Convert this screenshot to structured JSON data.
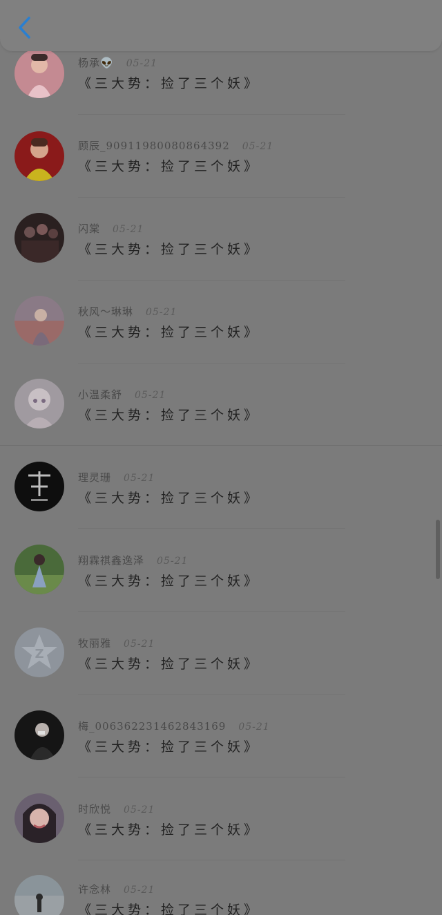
{
  "header": {
    "back_icon": "chevron-left-icon",
    "accent": "#2a7fd0"
  },
  "list": {
    "items": [
      {
        "name": "杨承👽",
        "time": "05-21",
        "title": "《三大势：捡了三个妖》",
        "avatar": "avatar-photo"
      },
      {
        "name": "顾辰_90911980080864392",
        "time": "05-21",
        "title": "《三大势：捡了三个妖》",
        "avatar": "avatar-photo"
      },
      {
        "name": "闪棠",
        "time": "05-21",
        "title": "《三大势：捡了三个妖》",
        "avatar": "avatar-photo"
      },
      {
        "name": "秋风～琳琳",
        "time": "05-21",
        "title": "《三大势：捡了三个妖》",
        "avatar": "avatar-photo"
      },
      {
        "name": "小温柔舒",
        "time": "05-21",
        "title": "《三大势：捡了三个妖》",
        "avatar": "avatar-photo"
      },
      {
        "name": "理灵珊",
        "time": "05-21",
        "title": "《三大势：捡了三个妖》",
        "avatar": "avatar-photo"
      },
      {
        "name": "翔霖祺鑫逸泽",
        "time": "05-21",
        "title": "《三大势：捡了三个妖》",
        "avatar": "avatar-photo"
      },
      {
        "name": "牧丽雅",
        "time": "05-21",
        "title": "《三大势：捡了三个妖》",
        "avatar": "avatar-default-qzone"
      },
      {
        "name": "梅_006362231462843169",
        "time": "05-21",
        "title": "《三大势：捡了三个妖》",
        "avatar": "avatar-photo"
      },
      {
        "name": "时欣悦",
        "time": "05-21",
        "title": "《三大势：捡了三个妖》",
        "avatar": "avatar-photo"
      },
      {
        "name": "许念林",
        "time": "05-21",
        "title": "《三大势：捡了三个妖》",
        "avatar": "avatar-photo"
      }
    ]
  }
}
